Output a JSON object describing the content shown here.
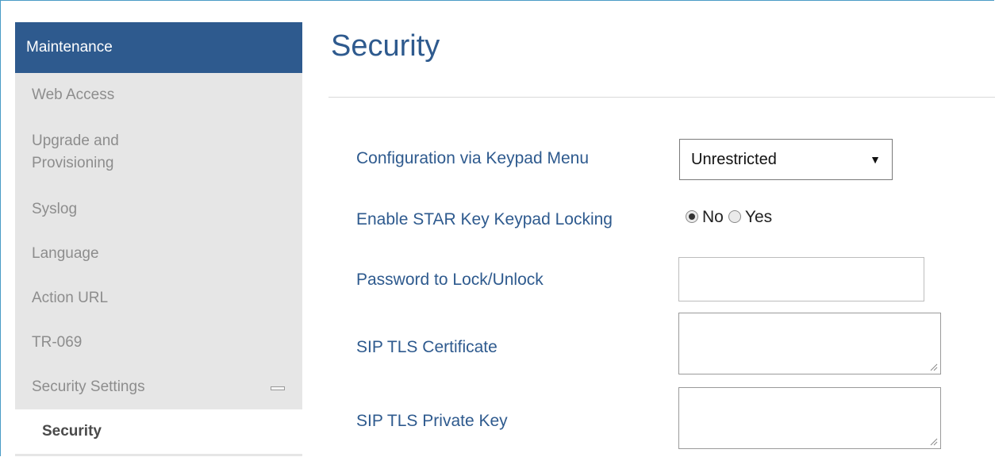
{
  "sidebar": {
    "header": "Maintenance",
    "items": [
      {
        "label": "Web Access"
      },
      {
        "label": "Upgrade and Provisioning"
      },
      {
        "label": "Syslog"
      },
      {
        "label": "Language"
      },
      {
        "label": "Action URL"
      },
      {
        "label": "TR-069"
      },
      {
        "label": "Security Settings",
        "icon": "minus-icon"
      }
    ],
    "active_sub_item": "Security"
  },
  "main": {
    "title": "Security",
    "fields": {
      "keypad_menu": {
        "label": "Configuration via Keypad Menu",
        "value": "Unrestricted",
        "arrow": "▼"
      },
      "star_lock": {
        "label": "Enable STAR Key Keypad Locking",
        "options": [
          "No",
          "Yes"
        ],
        "selected": "No"
      },
      "password": {
        "label": "Password to Lock/Unlock",
        "value": ""
      },
      "tls_cert": {
        "label": "SIP TLS Certificate",
        "value": ""
      },
      "tls_key": {
        "label": "SIP TLS Private Key",
        "value": ""
      }
    }
  },
  "colors": {
    "header_bg": "#2e5a8e",
    "accent_text": "#2e5a8e",
    "sidebar_bg": "#e6e6e6",
    "sidebar_text": "#8d8d8d"
  }
}
